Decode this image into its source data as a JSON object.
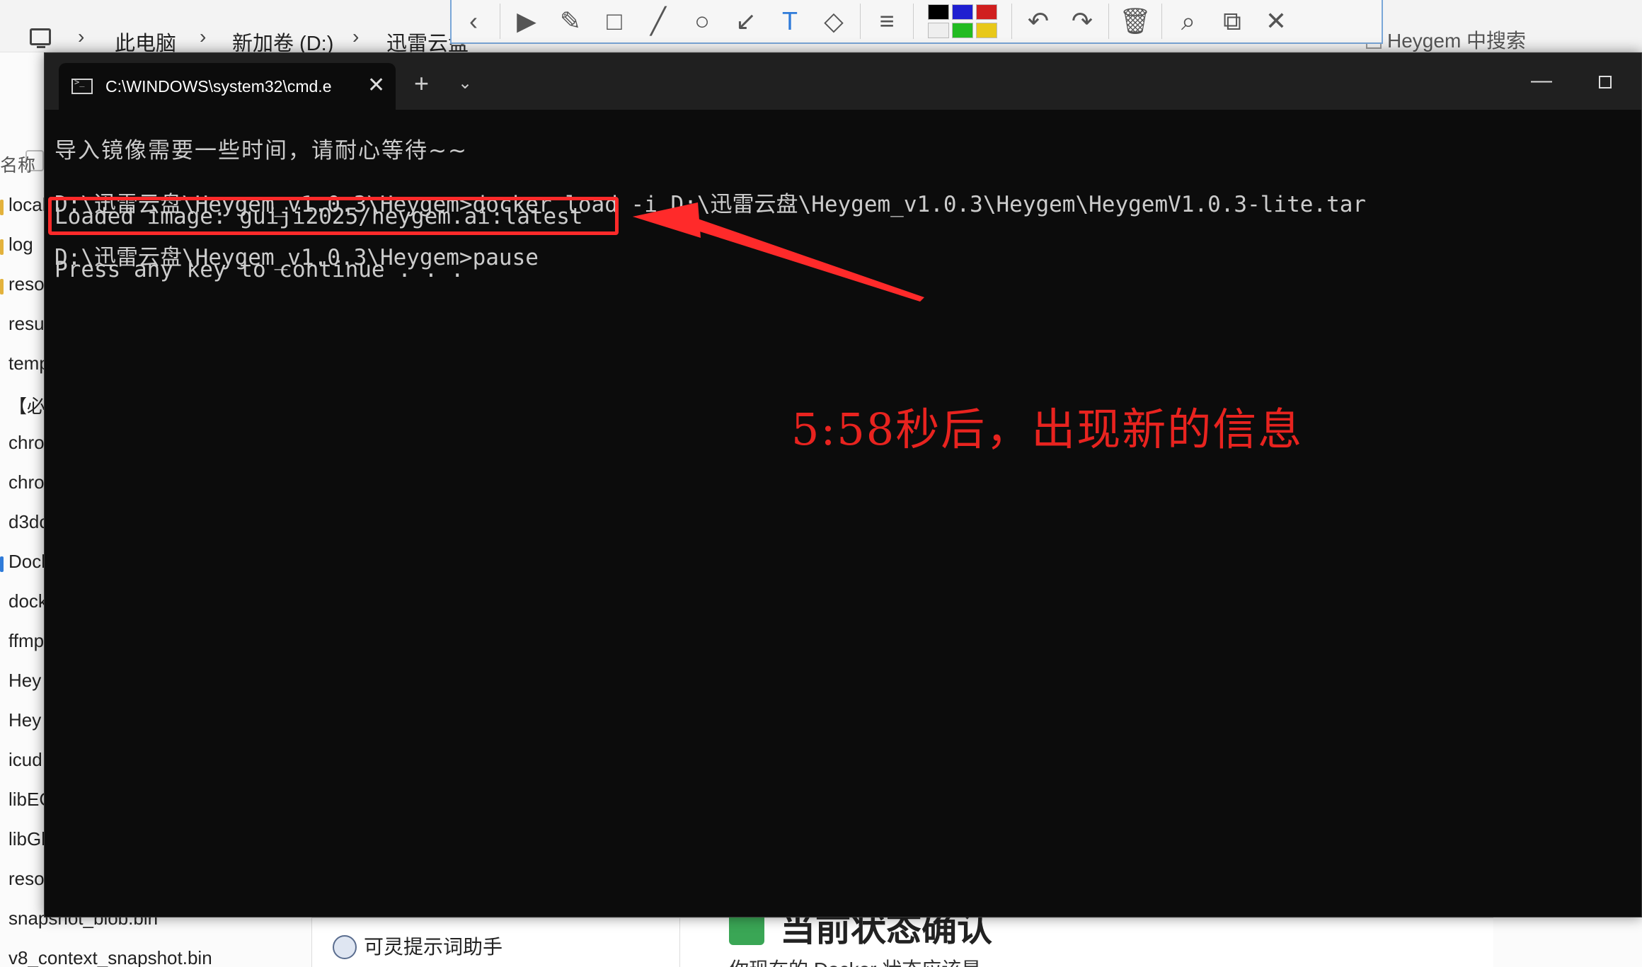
{
  "explorer": {
    "breadcrumbs": [
      "此电脑",
      "新加卷 (D:)",
      "迅雷云盘"
    ],
    "search_placeholder": "Heygem 中搜索",
    "column_header": "名称",
    "files": [
      "local",
      "log",
      "reso",
      "resu",
      "temp",
      "【必",
      "chro",
      "chro",
      "d3dc",
      "Dock",
      "dock",
      "ffmp",
      "Hey",
      "Hey",
      "icud",
      "libEC",
      "libGl",
      "reso",
      "snapshot_blob.bin",
      "v8_context_snapshot.bin"
    ],
    "helper_label": "可灵提示词助手",
    "doc_heading": "当前状态确认",
    "doc_text": "你现在的 Docker 状态应该是"
  },
  "toolbar": {
    "icons": [
      "back-icon",
      "pointer-icon",
      "pen-icon",
      "rectangle-icon",
      "line-icon",
      "ellipse-icon",
      "arrow-icon",
      "text-icon",
      "eraser-icon",
      "line-width-icon",
      "undo-icon",
      "redo-icon",
      "delete-icon",
      "zoom-icon",
      "copy-icon",
      "close-icon"
    ],
    "swatch_colors": [
      "#000000",
      "#1f1fd0",
      "#d01f1f",
      "#eeeeee",
      "#22bb22",
      "#e8c81a"
    ]
  },
  "terminal": {
    "tab_title": "C:\\WINDOWS\\system32\\cmd.e",
    "lines": [
      "导入镜像需要一些时间，请耐心等待~~",
      "",
      "D:\\迅雷云盘\\Heygem_v1.0.3\\Heygem>docker load -i D:\\迅雷云盘\\Heygem_v1.0.3\\Heygem\\HeygemV1.0.3-lite.tar",
      "Loaded image: guiji2025/heygem.ai:latest",
      "",
      "D:\\迅雷云盘\\Heygem_v1.0.3\\Heygem>pause",
      "Press any key to continue . . ."
    ]
  },
  "annotation": {
    "note": "5:58秒后，出现新的信息",
    "color": "#e8231f"
  }
}
